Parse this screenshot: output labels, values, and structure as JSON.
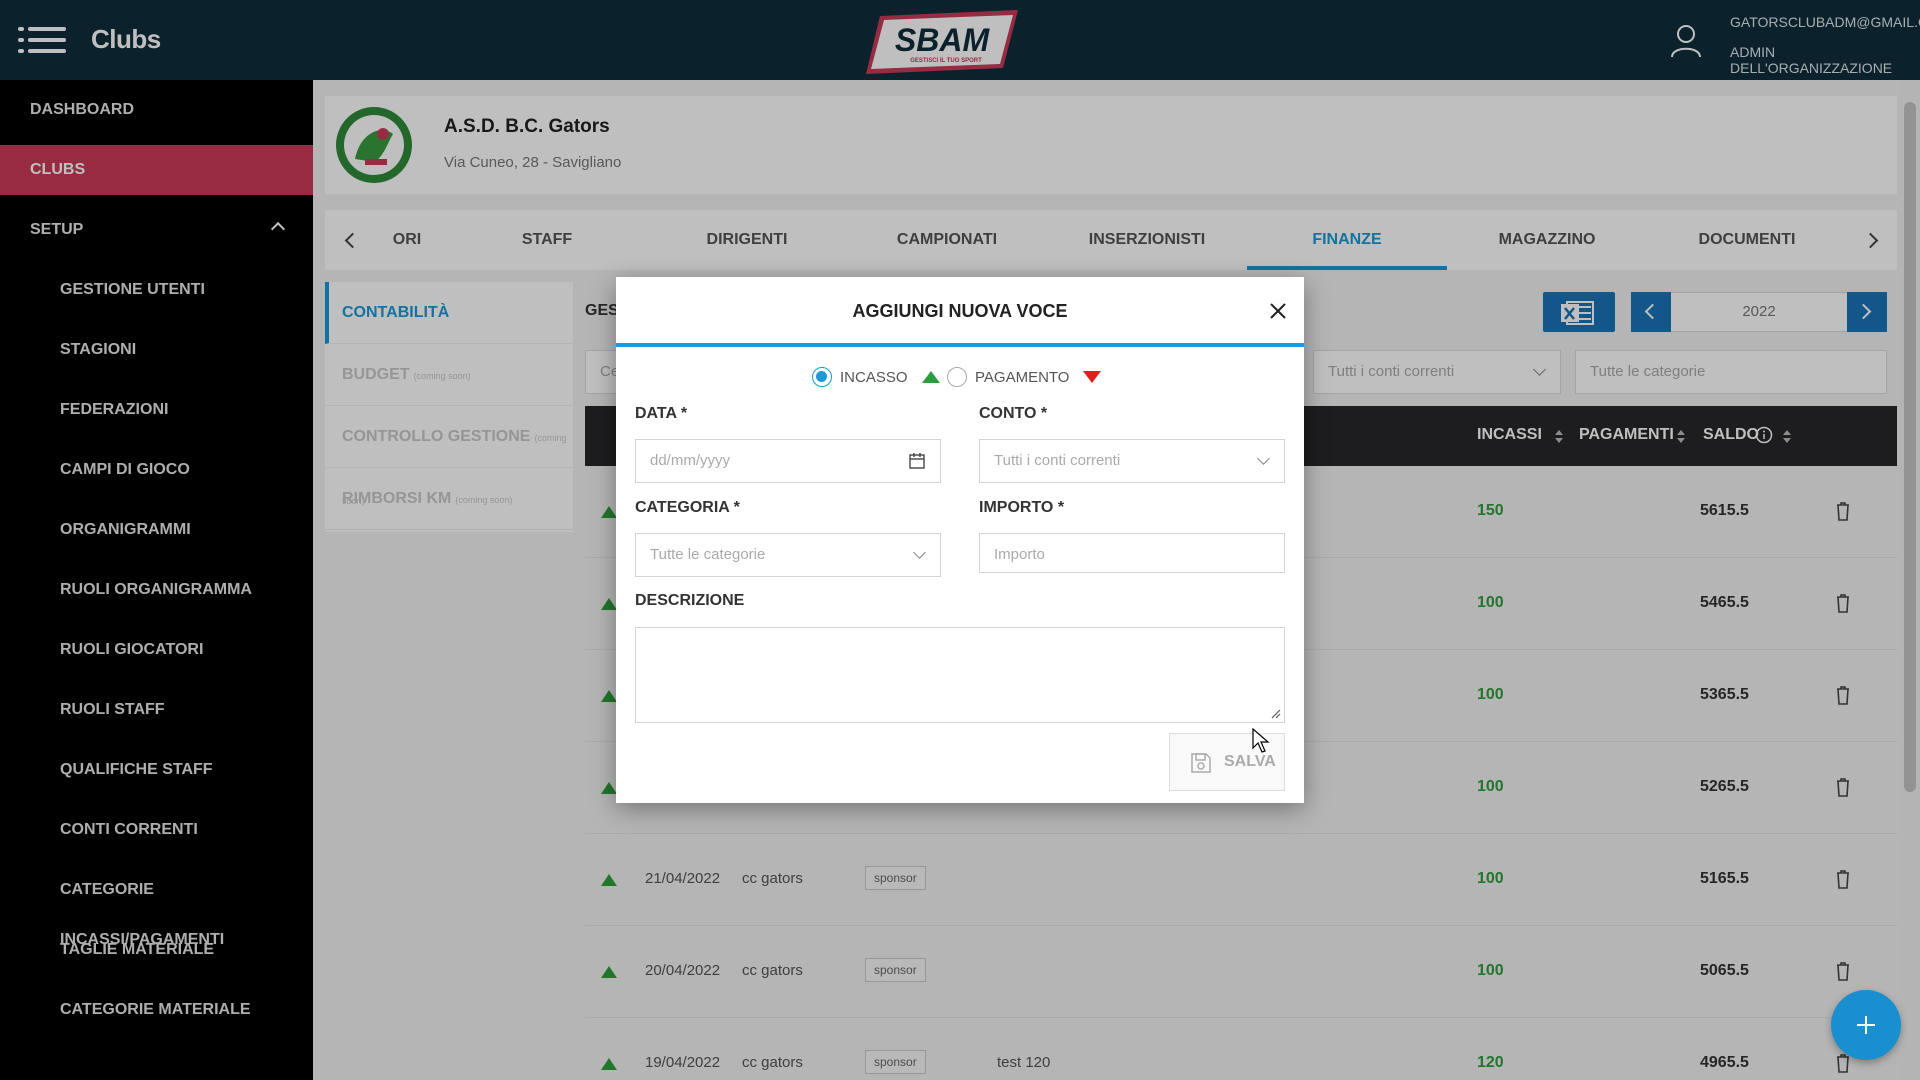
{
  "topbar": {
    "title": "Clubs",
    "user_email": "GATORSCLUBADM@GMAIL.COM",
    "user_role": "ADMIN DELL'ORGANIZZAZIONE",
    "logo_text": "SBAM",
    "logo_tagline": "GESTISCI IL TUO SPORT"
  },
  "sidebar": {
    "items": [
      {
        "label": "DASHBOARD"
      },
      {
        "label": "CLUBS"
      },
      {
        "label": "SETUP"
      },
      {
        "label": "GESTIONE UTENTI"
      },
      {
        "label": "STAGIONI"
      },
      {
        "label": "FEDERAZIONI"
      },
      {
        "label": "CAMPI DI GIOCO"
      },
      {
        "label": "ORGANIGRAMMI"
      },
      {
        "label": "RUOLI ORGANIGRAMMA"
      },
      {
        "label": "RUOLI GIOCATORI"
      },
      {
        "label": "RUOLI STAFF"
      },
      {
        "label": "QUALIFICHE STAFF"
      },
      {
        "label": "CONTI CORRENTI"
      },
      {
        "label": "CATEGORIE INCASSI/PAGAMENTI"
      },
      {
        "label": "TAGLIE MATERIALE"
      },
      {
        "label": "CATEGORIE MATERIALE"
      }
    ]
  },
  "club": {
    "name": "A.S.D. B.C. Gators",
    "address": "Via Cuneo, 28 - Savigliano"
  },
  "tabs": [
    "ORI",
    "STAFF",
    "DIRIGENTI",
    "CAMPIONATI",
    "INSERZIONISTI",
    "FINANZE",
    "MAGAZZINO",
    "DOCUMENTI"
  ],
  "subnav": [
    {
      "label": "CONTABILITÀ",
      "note": ""
    },
    {
      "label": "BUDGET",
      "note": "(coming soon)"
    },
    {
      "label": "CONTROLLO GESTIONE",
      "note": "(coming soon)"
    },
    {
      "label": "RIMBORSI KM",
      "note": "(coming soon)"
    }
  ],
  "section_label": "GEST",
  "year": "2022",
  "filters": {
    "first": "Ce",
    "accounts_placeholder": "Tutti i conti correnti",
    "categories_placeholder": "Tutte le categorie"
  },
  "table": {
    "headers": {
      "incassi": "INCASSI",
      "pagamenti": "PAGAMENTI",
      "saldo": "SALDO"
    },
    "rows": [
      {
        "date": "",
        "account": "",
        "category": "",
        "description": "",
        "incasso": "150",
        "saldo": "5615.5"
      },
      {
        "date": "",
        "account": "",
        "category": "",
        "description": "",
        "incasso": "100",
        "saldo": "5465.5"
      },
      {
        "date": "",
        "account": "",
        "category": "",
        "description": "",
        "incasso": "100",
        "saldo": "5365.5"
      },
      {
        "date": "",
        "account": "",
        "category": "",
        "description": "",
        "incasso": "100",
        "saldo": "5265.5"
      },
      {
        "date": "21/04/2022",
        "account": "cc gators",
        "category": "sponsor",
        "description": "",
        "incasso": "100",
        "saldo": "5165.5"
      },
      {
        "date": "20/04/2022",
        "account": "cc gators",
        "category": "sponsor",
        "description": "",
        "incasso": "100",
        "saldo": "5065.5"
      },
      {
        "date": "19/04/2022",
        "account": "cc gators",
        "category": "sponsor",
        "description": "test 120",
        "incasso": "120",
        "saldo": "4965.5"
      }
    ]
  },
  "modal": {
    "title": "AGGIUNGI NUOVA VOCE",
    "type_income": "INCASSO",
    "type_payment": "PAGAMENTO",
    "date_label": "DATA *",
    "date_placeholder": "dd/mm/yyyy",
    "account_label": "CONTO *",
    "account_placeholder": "Tutti i conti correnti",
    "category_label": "CATEGORIA *",
    "category_placeholder": "Tutte le categorie",
    "amount_label": "IMPORTO *",
    "amount_placeholder": "Importo",
    "description_label": "DESCRIZIONE",
    "save_label": "SALVA"
  },
  "colors": {
    "topbar": "#0f2e3d",
    "sidebar": "#000000",
    "active_sidebar": "#c93a59",
    "accent": "#1a9ad6",
    "income": "#2e9e3a",
    "payment": "#e01e1e"
  }
}
